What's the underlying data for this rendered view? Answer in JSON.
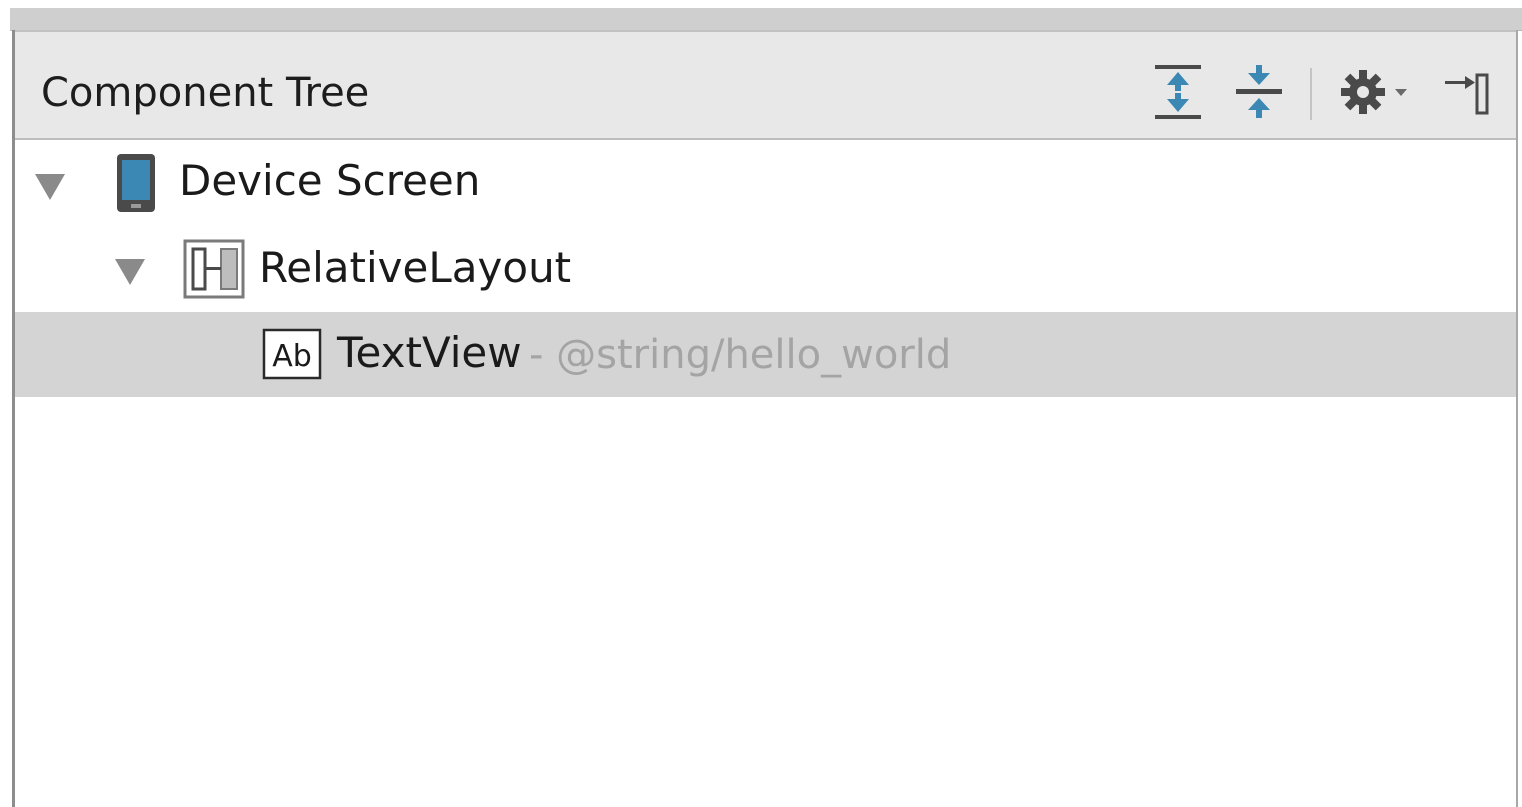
{
  "panel": {
    "title": "Component Tree"
  },
  "toolbar": {
    "tools": [
      {
        "icon": "expand-all-icon"
      },
      {
        "icon": "collapse-all-icon"
      },
      {
        "icon": "gear-menu-icon"
      },
      {
        "icon": "hide-panel-icon"
      }
    ]
  },
  "tree": {
    "nodes": [
      {
        "label": "Device Screen",
        "icon": "device-icon",
        "expanded": true
      },
      {
        "label": "RelativeLayout",
        "icon": "relative-layout-icon",
        "expanded": true
      },
      {
        "label": "TextView",
        "attr": "- @string/hello_world",
        "icon": "textview-icon",
        "selected": true
      }
    ]
  },
  "colors": {
    "accent": "#3b88b5",
    "selection": "#d4d4d4",
    "header_bg": "#e8e8e8"
  }
}
